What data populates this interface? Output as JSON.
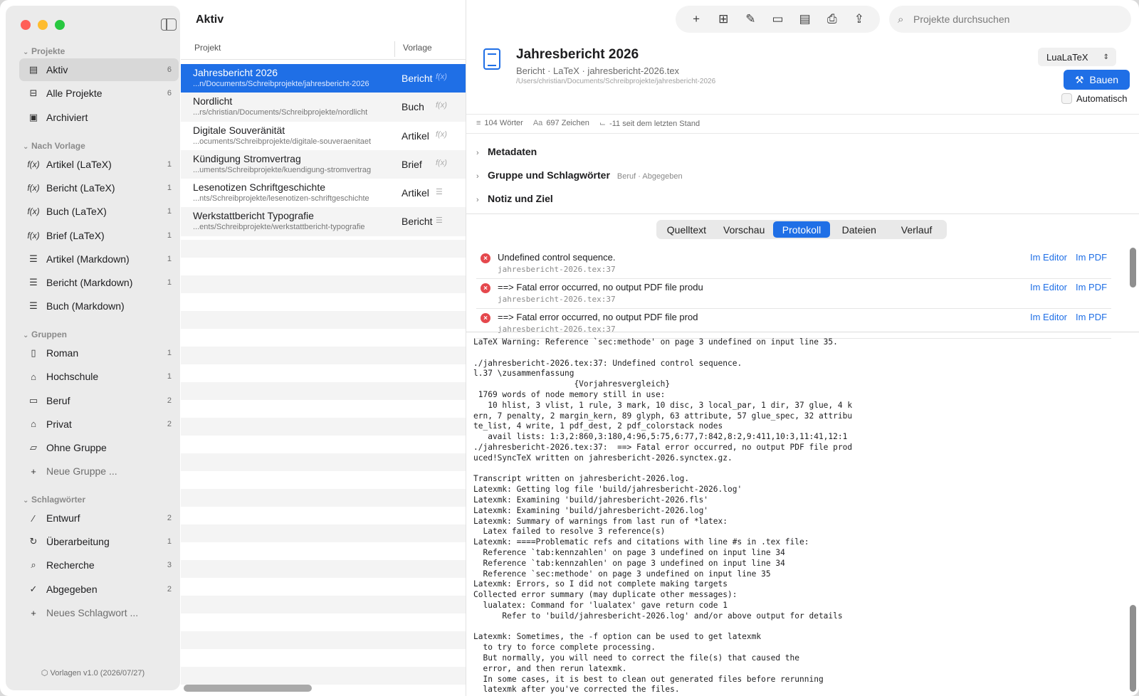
{
  "sidebar": {
    "section_projects": "Projekte",
    "projects": [
      {
        "label": "Aktiv",
        "count": "6",
        "icon": "clipboard-icon",
        "glyph": "▤"
      },
      {
        "label": "Alle Projekte",
        "count": "6",
        "icon": "tray-icon",
        "glyph": "⊟"
      },
      {
        "label": "Archiviert",
        "count": "",
        "icon": "archive-box-icon",
        "glyph": "▣"
      }
    ],
    "section_templates": "Nach Vorlage",
    "templates": [
      {
        "label": "Artikel (LaTeX)",
        "count": "1",
        "glyph": "f(x)"
      },
      {
        "label": "Bericht (LaTeX)",
        "count": "1",
        "glyph": "f(x)"
      },
      {
        "label": "Buch (LaTeX)",
        "count": "1",
        "glyph": "f(x)"
      },
      {
        "label": "Brief (LaTeX)",
        "count": "1",
        "glyph": "f(x)"
      },
      {
        "label": "Artikel (Markdown)",
        "count": "1",
        "glyph": "☰"
      },
      {
        "label": "Bericht (Markdown)",
        "count": "1",
        "glyph": "☰"
      },
      {
        "label": "Buch (Markdown)",
        "count": "",
        "glyph": "☰"
      }
    ],
    "section_groups": "Gruppen",
    "groups": [
      {
        "label": "Roman",
        "count": "1",
        "icon": "book-icon",
        "glyph": "▯"
      },
      {
        "label": "Hochschule",
        "count": "1",
        "icon": "graduation-cap-icon",
        "glyph": "⌂"
      },
      {
        "label": "Beruf",
        "count": "2",
        "icon": "briefcase-icon",
        "glyph": "▭"
      },
      {
        "label": "Privat",
        "count": "2",
        "icon": "house-icon",
        "glyph": "⌂"
      },
      {
        "label": "Ohne Gruppe",
        "count": "",
        "icon": "folder-badge-icon",
        "glyph": "▱"
      }
    ],
    "new_group": "Neue Gruppe ...",
    "section_tags": "Schlagwörter",
    "tags": [
      {
        "label": "Entwurf",
        "count": "2",
        "icon": "pencil-icon",
        "glyph": "∕"
      },
      {
        "label": "Überarbeitung",
        "count": "1",
        "icon": "arrows-circle-icon",
        "glyph": "↻"
      },
      {
        "label": "Recherche",
        "count": "3",
        "icon": "magnifier-icon",
        "glyph": "⌕"
      },
      {
        "label": "Abgegeben",
        "count": "2",
        "icon": "checkmark-seal-icon",
        "glyph": "✓"
      }
    ],
    "new_tag": "Neues Schlagwort ...",
    "footer": "Vorlagen v1.0 (2026/07/27)"
  },
  "list": {
    "title": "Aktiv",
    "col_project": "Projekt",
    "col_template": "Vorlage",
    "rows": [
      {
        "name": "Jahresbericht 2026",
        "path": "...n/Documents/Schreibprojekte/jahresbericht-2026",
        "type": "Bericht",
        "glyph": "f(x)"
      },
      {
        "name": "Nordlicht",
        "path": "...rs/christian/Documents/Schreibprojekte/nordlicht",
        "type": "Buch",
        "glyph": "f(x)"
      },
      {
        "name": "Digitale Souveränität",
        "path": "...ocuments/Schreibprojekte/digitale-souveraenitaet",
        "type": "Artikel",
        "glyph": "f(x)"
      },
      {
        "name": "Kündigung Stromvertrag",
        "path": "...uments/Schreibprojekte/kuendigung-stromvertrag",
        "type": "Brief",
        "glyph": "f(x)"
      },
      {
        "name": "Lesenotizen Schriftgeschichte",
        "path": "...nts/Schreibprojekte/lesenotizen-schriftgeschichte",
        "type": "Artikel",
        "glyph": "☰"
      },
      {
        "name": "Werkstattbericht Typografie",
        "path": "...ents/Schreibprojekte/werkstattbericht-typografie",
        "type": "Bericht",
        "glyph": "☰"
      }
    ]
  },
  "toolbar": {
    "buttons": [
      {
        "name": "add-icon",
        "glyph": "+"
      },
      {
        "name": "new-folder-icon",
        "glyph": "⊞"
      },
      {
        "name": "compose-icon",
        "glyph": "✎"
      },
      {
        "name": "folder-icon",
        "glyph": "▭"
      },
      {
        "name": "document-icon",
        "glyph": "▤"
      },
      {
        "name": "print-icon",
        "glyph": "⎙"
      },
      {
        "name": "share-icon",
        "glyph": "⇪"
      }
    ],
    "search_placeholder": "Projekte durchsuchen"
  },
  "detail": {
    "title": "Jahresbericht 2026",
    "subtitle": "Bericht · LaTeX · jahresbericht-2026.tex",
    "path": "/Users/christian/Documents/Schreibprojekte/jahresbericht-2026",
    "engine": "LuaLaTeX",
    "build_label": "Bauen",
    "auto_label": "Automatisch",
    "stats": {
      "words": "104 Wörter",
      "chars": "697 Zeichen",
      "delta": "-11 seit dem letzten Stand"
    },
    "sections": [
      {
        "label": "Metadaten",
        "sub": ""
      },
      {
        "label": "Gruppe und Schlagwörter",
        "sub": "Beruf · Abgegeben"
      },
      {
        "label": "Notiz und Ziel",
        "sub": ""
      }
    ],
    "tabs": [
      "Quelltext",
      "Vorschau",
      "Protokoll",
      "Dateien",
      "Verlauf"
    ],
    "active_tab": "Protokoll",
    "issues": [
      {
        "message": "Undefined control sequence.",
        "location": "jahresbericht-2026.tex:37"
      },
      {
        "message": "==> Fatal error occurred, no output PDF file produ",
        "location": "jahresbericht-2026.tex:37"
      },
      {
        "message": "==> Fatal error occurred, no output PDF file prod",
        "location": "jahresbericht-2026.tex:37"
      }
    ],
    "link_editor": "Im Editor",
    "link_pdf": "Im PDF",
    "log": "LaTeX Warning: Reference `sec:methode' on page 3 undefined on input line 35.\n\n./jahresbericht-2026.tex:37: Undefined control sequence.\nl.37 \\zusammenfassung\n                     {Vorjahresvergleich}\n 1769 words of node memory still in use:\n   10 hlist, 3 vlist, 1 rule, 3 mark, 10 disc, 3 local_par, 1 dir, 37 glue, 4 k\nern, 7 penalty, 2 margin_kern, 89 glyph, 63 attribute, 57 glue_spec, 32 attribu\nte_list, 4 write, 1 pdf_dest, 2 pdf_colorstack nodes\n   avail lists: 1:3,2:860,3:180,4:96,5:75,6:77,7:842,8:2,9:411,10:3,11:41,12:1\n./jahresbericht-2026.tex:37:  ==> Fatal error occurred, no output PDF file prod\nuced!SyncTeX written on jahresbericht-2026.synctex.gz.\n\nTranscript written on jahresbericht-2026.log.\nLatexmk: Getting log file 'build/jahresbericht-2026.log'\nLatexmk: Examining 'build/jahresbericht-2026.fls'\nLatexmk: Examining 'build/jahresbericht-2026.log'\nLatexmk: Summary of warnings from last run of *latex:\n  Latex failed to resolve 3 reference(s)\nLatexmk: ====Problematic refs and citations with line #s in .tex file:\n  Reference `tab:kennzahlen' on page 3 undefined on input line 34\n  Reference `tab:kennzahlen' on page 3 undefined on input line 34\n  Reference `sec:methode' on page 3 undefined on input line 35\nLatexmk: Errors, so I did not complete making targets\nCollected error summary (may duplicate other messages):\n  lualatex: Command for 'lualatex' gave return code 1\n      Refer to 'build/jahresbericht-2026.log' and/or above output for details\n\nLatexmk: Sometimes, the -f option can be used to get latexmk\n  to try to force complete processing.\n  But normally, you will need to correct the file(s) that caused the\n  error, and then rerun latexmk.\n  In some cases, it is best to clean out generated files before rerunning\n  latexmk after you've corrected the files."
  },
  "colors": {
    "accent": "#1f6fe6",
    "error": "#e5484d",
    "sidebar_bg": "#ebebeb"
  }
}
